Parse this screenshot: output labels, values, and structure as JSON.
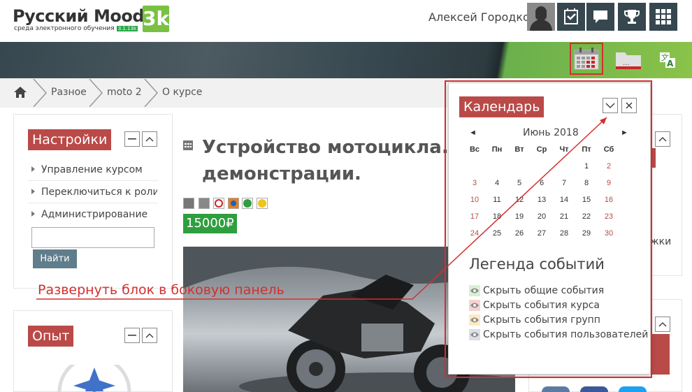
{
  "brand": {
    "name": "Русский Moodle",
    "badge": "3k",
    "subtitle": "среда электронного обучения",
    "version": "3.1.13k"
  },
  "header": {
    "user_name": "Алексей Городков"
  },
  "breadcrumb": [
    "Разное",
    "moto 2",
    "О курсе"
  ],
  "settings_block": {
    "title": "Настройки",
    "items": [
      "Управление курсом",
      "Переключиться к роли...",
      "Администрирование"
    ],
    "search_placeholder": "",
    "search_button": "Найти"
  },
  "experience_block": {
    "title": "Опыт"
  },
  "course": {
    "title_line1": "Устройство мотоцикла. Д",
    "title_line2": "демонстрации.",
    "price": "15000₽"
  },
  "right_fragments": {
    "tail": "жки"
  },
  "calendar": {
    "title": "Календарь",
    "month": "Июнь 2018",
    "prev": "◄",
    "next": "►",
    "weekdays": [
      "Вс",
      "Пн",
      "Вт",
      "Ср",
      "Чт",
      "Пт",
      "Сб"
    ],
    "weeks": [
      [
        "",
        "",
        "",
        "",
        "",
        "1",
        "2"
      ],
      [
        "3",
        "4",
        "5",
        "6",
        "7",
        "8",
        "9"
      ],
      [
        "10",
        "11",
        "12",
        "13",
        "14",
        "15",
        "16"
      ],
      [
        "17",
        "18",
        "19",
        "20",
        "21",
        "22",
        "23"
      ],
      [
        "24",
        "25",
        "26",
        "27",
        "28",
        "29",
        "30"
      ]
    ],
    "legend_title": "Легенда событий",
    "legend": [
      {
        "label": "Скрыть общие события",
        "color": "#d9f0d3"
      },
      {
        "label": "Скрыть события курса",
        "color": "#f6d3d0"
      },
      {
        "label": "Скрыть события групп",
        "color": "#fde9c2"
      },
      {
        "label": "Скрыть события пользователей",
        "color": "#dcdfe3"
      }
    ]
  },
  "annotation": {
    "text": "Развернуть блок в боковую панель",
    "color": "#d32f2f"
  },
  "colors": {
    "accent": "#b94a48",
    "dark": "#37474f",
    "green": "#2e9e3e",
    "highlight": "#d32f2f"
  }
}
